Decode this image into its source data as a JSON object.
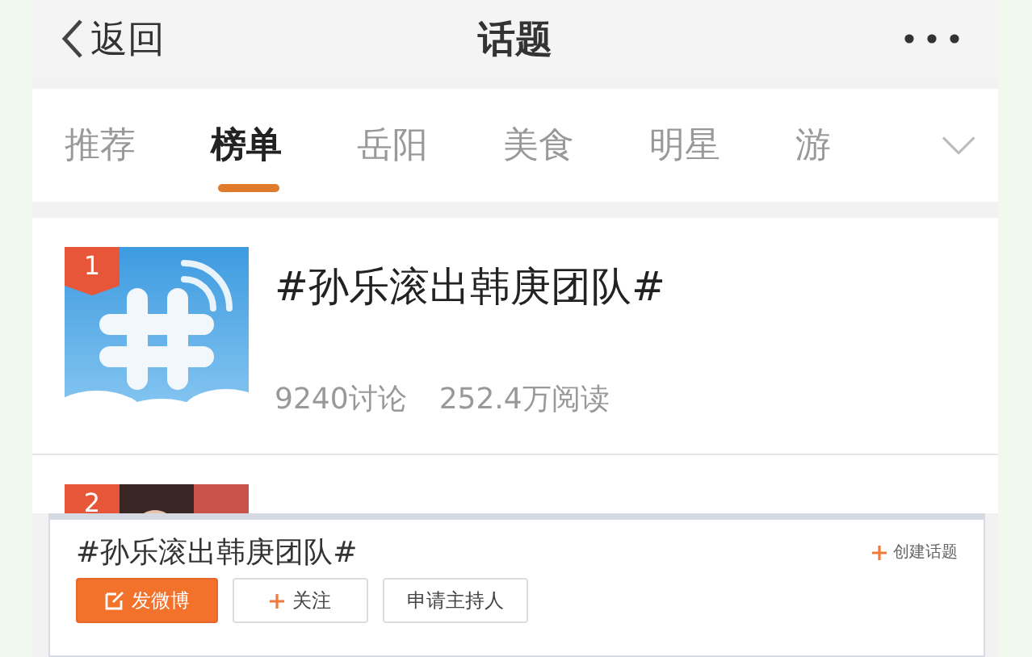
{
  "header": {
    "back_label": "返回",
    "title": "话题"
  },
  "tabs": [
    {
      "label": "推荐",
      "selected": false
    },
    {
      "label": "榜单",
      "selected": true
    },
    {
      "label": "岳阳",
      "selected": false
    },
    {
      "label": "美食",
      "selected": false
    },
    {
      "label": "明星",
      "selected": false
    },
    {
      "label": "游",
      "selected": false
    }
  ],
  "topics": [
    {
      "rank": "1",
      "kind": "hashtag",
      "title": "#孙乐滚出韩庚团队#",
      "discussions": "9240讨论",
      "reads": "252.4万阅读"
    },
    {
      "rank": "2",
      "kind": "picture"
    }
  ],
  "overlay": {
    "title": "#孙乐滚出韩庚团队#",
    "create_label": "创建话题",
    "buttons": [
      {
        "label": "发微博",
        "kind": "primary"
      },
      {
        "label": "关注",
        "kind": "follow"
      },
      {
        "label": "申请主持人",
        "kind": "plain"
      }
    ]
  }
}
